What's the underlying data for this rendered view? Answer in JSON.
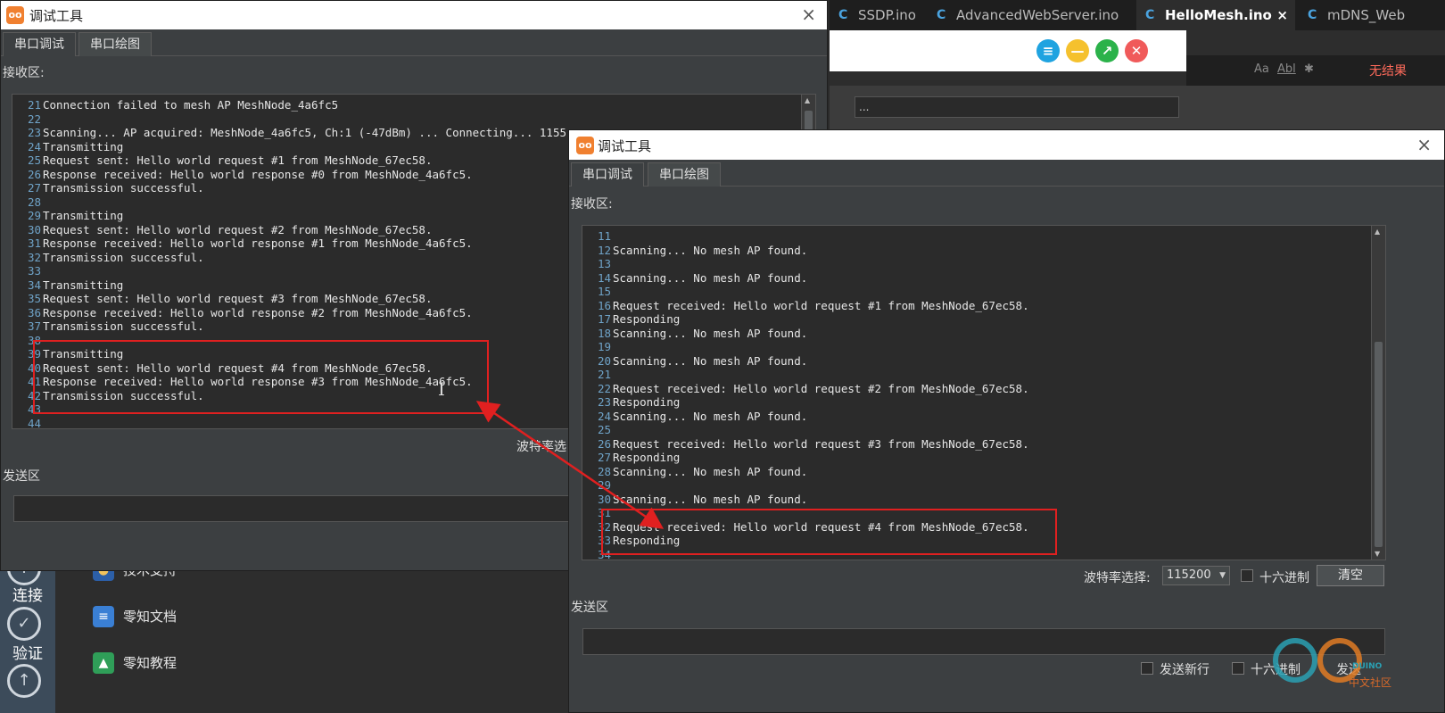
{
  "ide": {
    "tabs": [
      {
        "label": "SSDP.ino",
        "active": false
      },
      {
        "label": "AdvancedWebServer.ino",
        "active": false
      },
      {
        "label": "HelloMesh.ino",
        "active": true,
        "close": "×"
      },
      {
        "label": "mDNS_Web",
        "active": false
      }
    ],
    "search_options": [
      "Aa",
      "Abl",
      "✱"
    ],
    "no_result_label": "无结果",
    "inner_bar_text": "..."
  },
  "toolbar": {
    "buttons": [
      {
        "name": "menu-button",
        "glyph": "≡",
        "color": "#1fa3e0"
      },
      {
        "name": "minimize-button",
        "glyph": "—",
        "color": "#f5c12e"
      },
      {
        "name": "maximize-button",
        "glyph": "↗",
        "color": "#2bb24a"
      },
      {
        "name": "close-button",
        "glyph": "✕",
        "color": "#f05a5a"
      }
    ]
  },
  "sidebar": {
    "items": [
      {
        "label": "连接",
        "icon": "link-icon",
        "glyph": "Y"
      },
      {
        "label": "验证",
        "icon": "check-icon",
        "glyph": "✓"
      },
      {
        "label": "",
        "icon": "upload-icon",
        "glyph": "↑"
      }
    ]
  },
  "help_panel": {
    "items": [
      {
        "label": "技术支持",
        "icon": "support-icon"
      },
      {
        "label": "零知文档",
        "icon": "docs-icon"
      },
      {
        "label": "零知教程",
        "icon": "tutorial-icon"
      }
    ]
  },
  "window_left": {
    "title": "调试工具",
    "close_glyph": "×",
    "tabs": [
      "串口调试",
      "串口绘图"
    ],
    "receive_label": "接收区:",
    "send_label": "发送区",
    "baud_label": "波特率选",
    "lines": [
      {
        "n": "21",
        "t": "Connection failed to mesh AP MeshNode_4a6fc5"
      },
      {
        "n": "22",
        "t": ""
      },
      {
        "n": "23",
        "t": "Scanning... AP acquired: MeshNode_4a6fc5, Ch:1 (-47dBm) ... Connecting... 1155"
      },
      {
        "n": "24",
        "t": "Transmitting"
      },
      {
        "n": "25",
        "t": "Request sent: Hello world request #1 from MeshNode_67ec58."
      },
      {
        "n": "26",
        "t": "Response received: Hello world response #0 from MeshNode_4a6fc5."
      },
      {
        "n": "27",
        "t": "Transmission successful."
      },
      {
        "n": "28",
        "t": ""
      },
      {
        "n": "29",
        "t": "Transmitting"
      },
      {
        "n": "30",
        "t": "Request sent: Hello world request #2 from MeshNode_67ec58."
      },
      {
        "n": "31",
        "t": "Response received: Hello world response #1 from MeshNode_4a6fc5."
      },
      {
        "n": "32",
        "t": "Transmission successful."
      },
      {
        "n": "33",
        "t": ""
      },
      {
        "n": "34",
        "t": "Transmitting"
      },
      {
        "n": "35",
        "t": "Request sent: Hello world request #3 from MeshNode_67ec58."
      },
      {
        "n": "36",
        "t": "Response received: Hello world response #2 from MeshNode_4a6fc5."
      },
      {
        "n": "37",
        "t": "Transmission successful."
      },
      {
        "n": "38",
        "t": ""
      },
      {
        "n": "39",
        "t": "Transmitting"
      },
      {
        "n": "40",
        "t": "Request sent: Hello world request #4 from MeshNode_67ec58."
      },
      {
        "n": "41",
        "t": "Response received: Hello world response #3 from MeshNode_4a6fc5."
      },
      {
        "n": "42",
        "t": "Transmission successful."
      },
      {
        "n": "43",
        "t": ""
      },
      {
        "n": "44",
        "t": ""
      }
    ]
  },
  "window_right": {
    "title": "调试工具",
    "close_glyph": "×",
    "tabs": [
      "串口调试",
      "串口绘图"
    ],
    "receive_label": "接收区:",
    "send_label": "发送区",
    "baud_label": "波特率选择:",
    "baud_value": "115200",
    "hex_label": "十六进制",
    "clear_label": "清空",
    "newline_label": "发送新行",
    "send_hex_label": "十六进制",
    "send_label_btn": "发送",
    "lines": [
      {
        "n": "11",
        "t": ""
      },
      {
        "n": "12",
        "t": "Scanning... No mesh AP found."
      },
      {
        "n": "13",
        "t": ""
      },
      {
        "n": "14",
        "t": "Scanning... No mesh AP found."
      },
      {
        "n": "15",
        "t": ""
      },
      {
        "n": "16",
        "t": "Request received: Hello world request #1 from MeshNode_67ec58."
      },
      {
        "n": "17",
        "t": "Responding"
      },
      {
        "n": "18",
        "t": "Scanning... No mesh AP found."
      },
      {
        "n": "19",
        "t": ""
      },
      {
        "n": "20",
        "t": "Scanning... No mesh AP found."
      },
      {
        "n": "21",
        "t": ""
      },
      {
        "n": "22",
        "t": "Request received: Hello world request #2 from MeshNode_67ec58."
      },
      {
        "n": "23",
        "t": "Responding"
      },
      {
        "n": "24",
        "t": "Scanning... No mesh AP found."
      },
      {
        "n": "25",
        "t": ""
      },
      {
        "n": "26",
        "t": "Request received: Hello world request #3 from MeshNode_67ec58."
      },
      {
        "n": "27",
        "t": "Responding"
      },
      {
        "n": "28",
        "t": "Scanning... No mesh AP found."
      },
      {
        "n": "29",
        "t": ""
      },
      {
        "n": "30",
        "t": "Scanning... No mesh AP found."
      },
      {
        "n": "31",
        "t": ""
      },
      {
        "n": "32",
        "t": "Request received: Hello world request #4 from MeshNode_67ec58."
      },
      {
        "n": "33",
        "t": "Responding"
      },
      {
        "n": "34",
        "t": ""
      }
    ]
  },
  "watermark": {
    "text": "中文社区",
    "brand": "DUINO"
  }
}
